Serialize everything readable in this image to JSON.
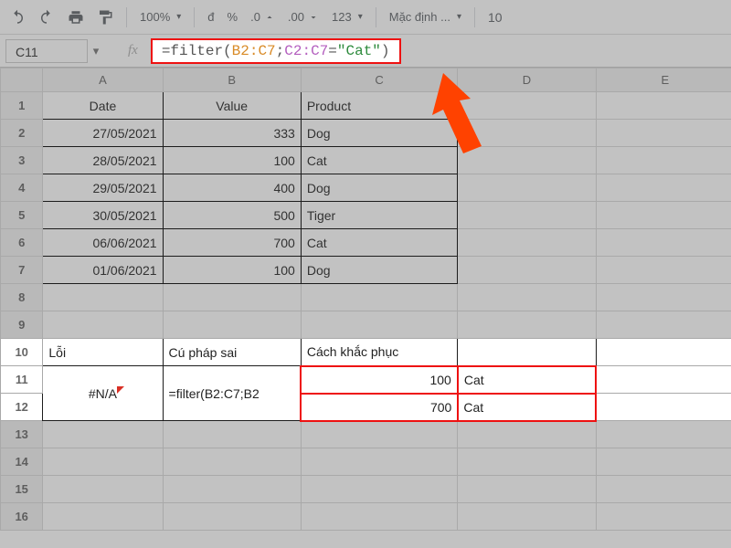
{
  "toolbar": {
    "zoom": "100%",
    "currency_icon": "đ",
    "percent_icon": "%",
    "dec_dec": ".0",
    "inc_dec": ".00",
    "numfmt": "123",
    "font_label": "Mặc định ...",
    "font_size": "10"
  },
  "namebox": "C11",
  "fx_label": "fx",
  "formula": {
    "fn_open": "=filter(",
    "range1": "B2:C7",
    "sep1": ";",
    "range2": "C2:C7",
    "eq": "=",
    "str": "\"Cat\"",
    "close": ")"
  },
  "columns": [
    "A",
    "B",
    "C",
    "D",
    "E"
  ],
  "rows": [
    "1",
    "2",
    "3",
    "4",
    "5",
    "6",
    "7",
    "8",
    "9",
    "10",
    "11",
    "12",
    "13",
    "14",
    "15",
    "16"
  ],
  "table1": {
    "headers": {
      "A": "Date",
      "B": "Value",
      "C": "Product"
    },
    "rows": [
      {
        "A": "27/05/2021",
        "B": "333",
        "C": "Dog"
      },
      {
        "A": "28/05/2021",
        "B": "100",
        "C": "Cat"
      },
      {
        "A": "29/05/2021",
        "B": "400",
        "C": "Dog"
      },
      {
        "A": "30/05/2021",
        "B": "500",
        "C": "Tiger"
      },
      {
        "A": "06/06/2021",
        "B": "700",
        "C": "Cat"
      },
      {
        "A": "01/06/2021",
        "B": "100",
        "C": "Dog"
      }
    ]
  },
  "table2": {
    "r10": {
      "A": "Lỗi",
      "B": "Cú pháp sai",
      "C": "Cách khắc phục",
      "D": ""
    },
    "r11": {
      "A": "#N/A",
      "B": "=filter(B2:C7;B2",
      "C": "100",
      "D": "Cat"
    },
    "r12": {
      "A": "",
      "B": "",
      "C": "700",
      "D": "Cat"
    }
  }
}
